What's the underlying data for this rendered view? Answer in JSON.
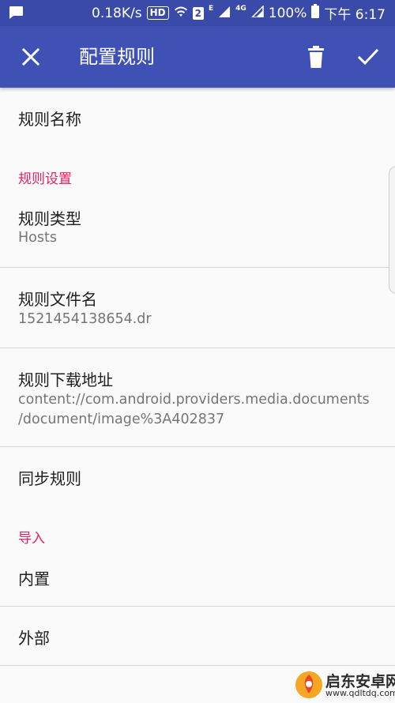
{
  "status_bar": {
    "speed": "0.18K/s",
    "hd": "HD",
    "sim_badge": "2",
    "network_e": "E",
    "network_4g": "4G",
    "battery": "100%",
    "time": "下午 6:17"
  },
  "toolbar": {
    "title": "配置规则"
  },
  "items": {
    "rule_name": "规则名称",
    "rule_settings_header": "规则设置",
    "rule_type_title": "规则类型",
    "rule_type_value": "Hosts",
    "rule_file_title": "规则文件名",
    "rule_file_value": "1521454138654.dr",
    "rule_url_title": "规则下载地址",
    "rule_url_line1": "content://com.android.providers.media.documents",
    "rule_url_line2": "/document/image%3A402837",
    "sync_rules": "同步规则",
    "import_header": "导入",
    "builtin": "内置",
    "external": "外部"
  },
  "watermark": {
    "name": "启东安卓网",
    "url": "www.qdltdq.com"
  },
  "colors": {
    "toolbar": "#3f51b5",
    "status_bar": "#3a4aa8",
    "accent": "#e91e63"
  }
}
